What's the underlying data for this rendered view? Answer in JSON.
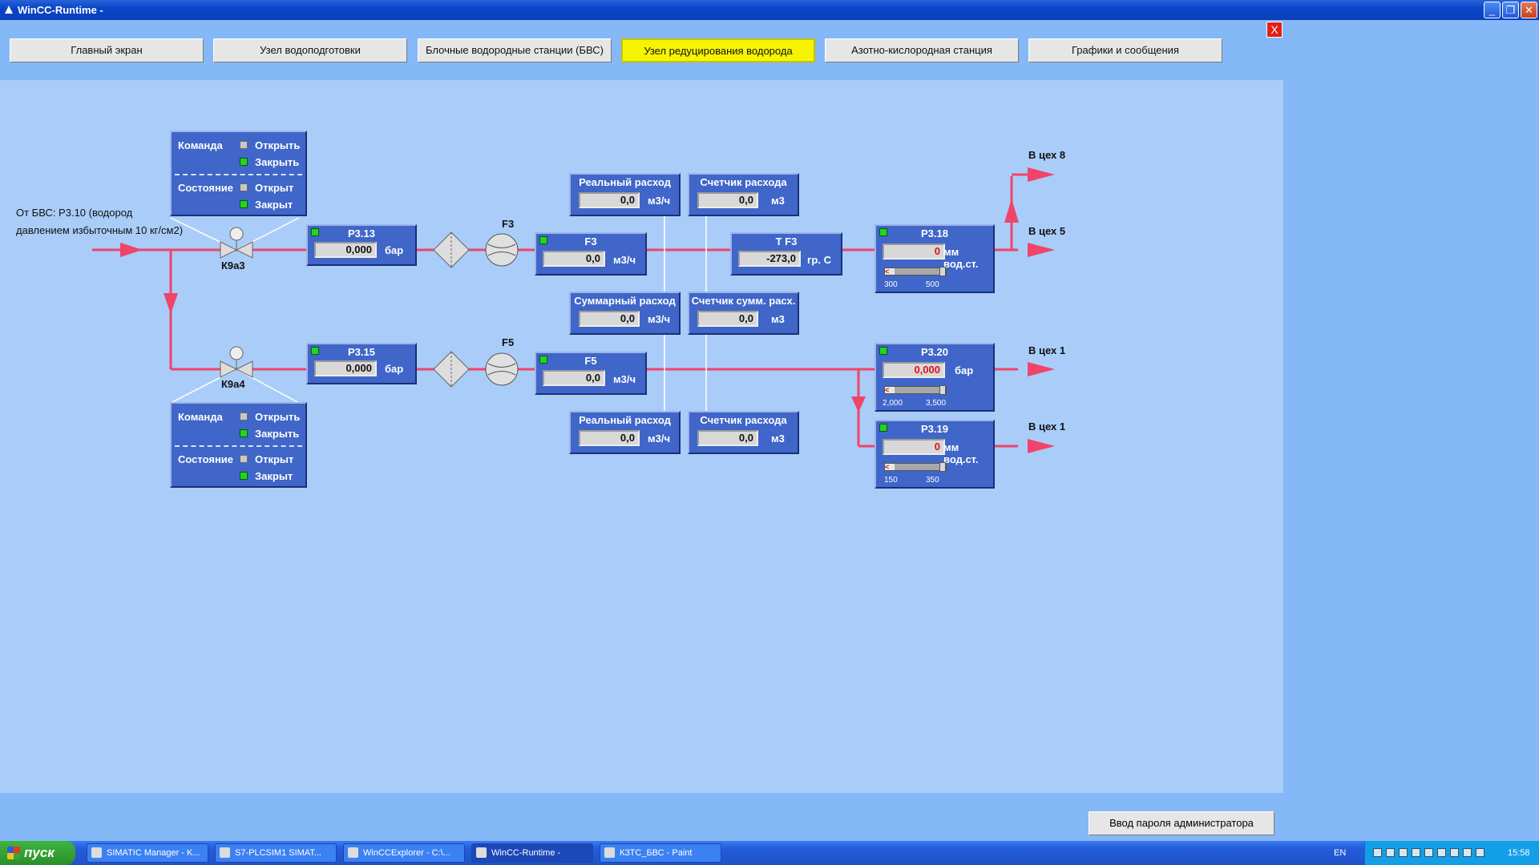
{
  "window": {
    "title": "WinCC-Runtime -"
  },
  "nav": [
    {
      "label": "Главный экран"
    },
    {
      "label": "Узел водоподготовки"
    },
    {
      "label": "Блочные водородные станции (БВС)"
    },
    {
      "label": "Узел редуцирования водорода"
    },
    {
      "label": "Азотно-кислородная станция"
    },
    {
      "label": "Графики и сообщения"
    }
  ],
  "close_x": "X",
  "source_text": {
    "line1": "От БВС: Р3.10 (водород",
    "line2": "давлением избыточным 10 кг/см2)"
  },
  "valves": {
    "k9a3": "К9а3",
    "k9a4": "К9а4"
  },
  "flow_labels": {
    "f3": "F3",
    "f5": "F5"
  },
  "outlets": {
    "o1": "В цех 8",
    "o2": "В цех 5",
    "o3": "В цех 1",
    "o4": "В цех 1"
  },
  "cmd1": {
    "command": "Команда",
    "open": "Открыть",
    "close": "Закрыть",
    "state": "Состояние",
    "opened": "Открыт",
    "closed": "Закрыт"
  },
  "cmd2": {
    "command": "Команда",
    "open": "Открыть",
    "close": "Закрыть",
    "state": "Состояние",
    "opened": "Открыт",
    "closed": "Закрыт"
  },
  "p313": {
    "title": "Р3.13",
    "value": "0,000",
    "unit": "бар"
  },
  "p315": {
    "title": "Р3.15",
    "value": "0,000",
    "unit": "бар"
  },
  "f3": {
    "title": "F3",
    "value": "0,0",
    "unit": "м3/ч"
  },
  "f5": {
    "title": "F5",
    "value": "0,0",
    "unit": "м3/ч"
  },
  "tf3": {
    "title": "Т F3",
    "value": "-273,0",
    "unit": "гр. С"
  },
  "rr1": {
    "title": "Реальный расход",
    "value": "0,0",
    "unit": "м3/ч"
  },
  "sc1": {
    "title": "Счетчик расхода",
    "value": "0,0",
    "unit": "м3"
  },
  "sum": {
    "title": "Суммарный расход",
    "value": "0,0",
    "unit": "м3/ч"
  },
  "scs": {
    "title": "Счетчик сумм. расх.",
    "value": "0,0",
    "unit": "м3"
  },
  "rr2": {
    "title": "Реальный расход",
    "value": "0,0",
    "unit": "м3/ч"
  },
  "sc2": {
    "title": "Счетчик расхода",
    "value": "0,0",
    "unit": "м3"
  },
  "p318": {
    "title": "Р3.18",
    "value": "0",
    "unit": "мм вод.ст.",
    "min": "300",
    "max": "500"
  },
  "p320": {
    "title": "Р3.20",
    "value": "0,000",
    "unit": "бар",
    "min": "2,000",
    "max": "3,500"
  },
  "p319": {
    "title": "Р3.19",
    "value": "0",
    "unit": "мм вод.ст.",
    "min": "150",
    "max": "350"
  },
  "admin_button": "Ввод пароля администратора",
  "taskbar": {
    "start": "пуск",
    "tasks": [
      {
        "label": "SIMATIC Manager - K..."
      },
      {
        "label": "S7-PLCSIM1    SIMAT..."
      },
      {
        "label": "WinCCExplorer - C:\\..."
      },
      {
        "label": "WinCC-Runtime -"
      },
      {
        "label": "КЗТС_БВС - Paint"
      }
    ],
    "lang": "EN",
    "clock": "15:58"
  },
  "colors": {
    "pipe": "#f0446a",
    "box": "#3f66c8",
    "panel": "#a9cdf8",
    "background": "#84b8f6",
    "active_nav": "#f6f400"
  }
}
